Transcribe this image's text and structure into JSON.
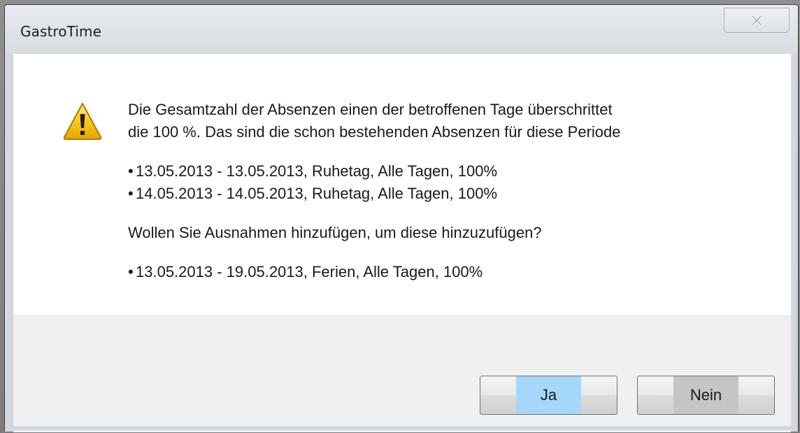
{
  "window": {
    "title": "GastroTime"
  },
  "message": {
    "intro_line1": "Die Gesamtzahl der Absenzen einen der betroffenen Tage überschrittet",
    "intro_line2": "die 100 %. Das sind die schon bestehenden Absenzen für diese Periode",
    "existing_absences": [
      "13.05.2013 - 13.05.2013, Ruhetag, Alle Tagen, 100%",
      "14.05.2013 - 14.05.2013, Ruhetag, Alle Tagen, 100%"
    ],
    "question": "Wollen Sie Ausnahmen hinzufügen, um diese hinzuzufügen?",
    "new_absences": [
      "13.05.2013 - 19.05.2013, Ferien, Alle Tagen, 100%"
    ]
  },
  "buttons": {
    "yes_label": "Ja",
    "no_label": "Nein"
  },
  "icons": {
    "warning": "warning-icon",
    "close": "close-icon"
  },
  "colors": {
    "warning_fill": "#f2c200",
    "yes_highlight": "#a5d7fb",
    "no_highlight": "#c5c5c5"
  }
}
